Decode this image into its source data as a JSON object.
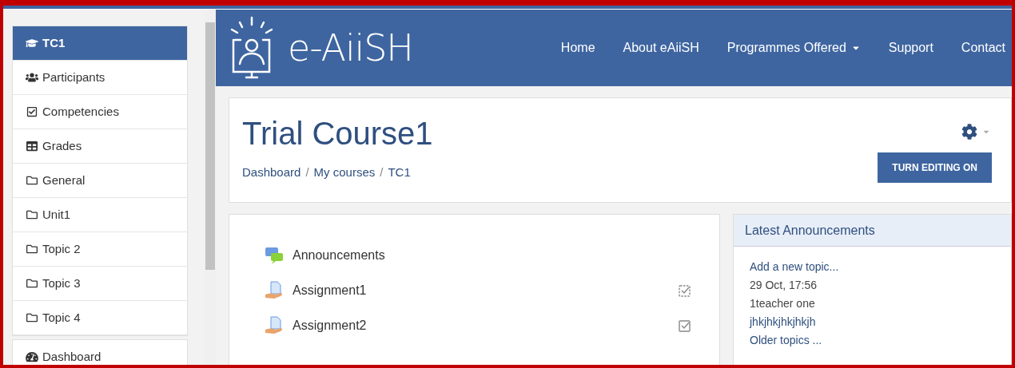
{
  "sidebar": {
    "items": [
      {
        "label": "TC1",
        "kind": "cap",
        "selected": true
      },
      {
        "label": "Participants",
        "kind": "users",
        "selected": false
      },
      {
        "label": "Competencies",
        "kind": "check",
        "selected": false
      },
      {
        "label": "Grades",
        "kind": "table",
        "selected": false
      },
      {
        "label": "General",
        "kind": "folder",
        "selected": false
      },
      {
        "label": "Unit1",
        "kind": "folder",
        "selected": false
      },
      {
        "label": "Topic 2",
        "kind": "folder",
        "selected": false
      },
      {
        "label": "Topic 3",
        "kind": "folder",
        "selected": false
      },
      {
        "label": "Topic 4",
        "kind": "folder",
        "selected": false
      }
    ],
    "bottom_items": [
      {
        "label": "Dashboard",
        "kind": "gauge",
        "selected": false
      }
    ]
  },
  "header": {
    "logo": "e-AiiSH",
    "nav": [
      {
        "label": "Home",
        "dropdown": false
      },
      {
        "label": "About eAiiSH",
        "dropdown": false
      },
      {
        "label": "Programmes Offered",
        "dropdown": true
      },
      {
        "label": "Support",
        "dropdown": false
      },
      {
        "label": "Contact",
        "dropdown": false
      }
    ]
  },
  "course": {
    "title": "Trial Course1",
    "breadcrumb": [
      "Dashboard",
      "My courses",
      "TC1"
    ],
    "breadcrumb_separators": [
      "/",
      "/"
    ],
    "edit_button": "TURN EDITING ON"
  },
  "activities": [
    {
      "label": "Announcements",
      "kind": "forum"
    },
    {
      "label": "Assignment1",
      "kind": "assignment",
      "automatic": true
    },
    {
      "label": "Assignment2",
      "kind": "assignment",
      "automatic": false
    }
  ],
  "announcements_block": {
    "title": "Latest Announcements",
    "lines": [
      {
        "text": "Add a new topic...",
        "kind": "link"
      },
      {
        "text": "29 Oct, 17:56",
        "kind": "meta"
      },
      {
        "text": "1teacher one",
        "kind": "meta"
      },
      {
        "text": "jhkjhkjhkjhkjh",
        "kind": "link"
      },
      {
        "text": "Older topics ...",
        "kind": "link"
      }
    ]
  }
}
